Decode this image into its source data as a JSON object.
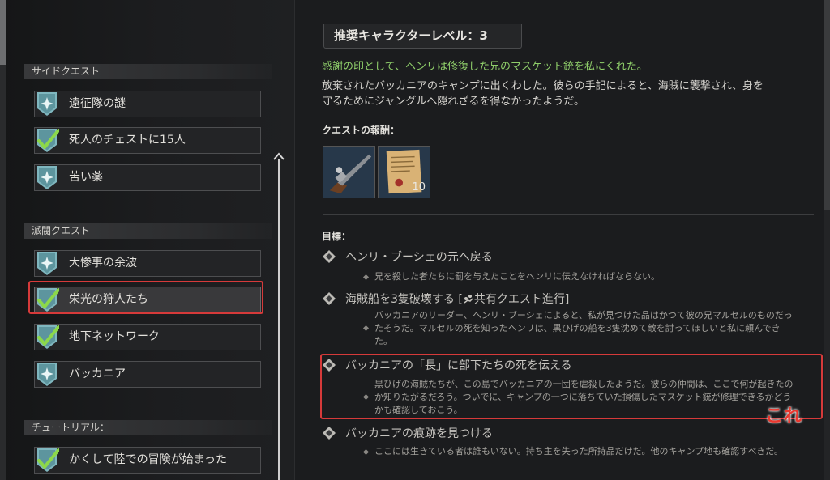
{
  "sidebar": {
    "sections": [
      {
        "title": "サイドクエスト",
        "items": [
          {
            "label": "遠征隊の謎",
            "icon": "compass-shield-icon",
            "completed": false
          },
          {
            "label": "死人のチェストに15人",
            "icon": "checkmark-shield-icon",
            "completed": true
          },
          {
            "label": "苦い薬",
            "icon": "compass-shield-icon",
            "completed": false
          }
        ]
      },
      {
        "title": "派閥クエスト",
        "items": [
          {
            "label": "大惨事の余波",
            "icon": "compass-shield-icon",
            "completed": false
          },
          {
            "label": "栄光の狩人たち",
            "icon": "checkmark-shield-icon",
            "completed": true,
            "selected": true
          },
          {
            "label": "地下ネットワーク",
            "icon": "checkmark-shield-icon",
            "completed": true
          },
          {
            "label": "バッカニア",
            "icon": "compass-shield-icon",
            "completed": false
          }
        ]
      },
      {
        "title": "チュートリアル：",
        "items": [
          {
            "label": "かくして陸での冒険が始まった",
            "icon": "checkmark-shield-icon",
            "completed": true
          }
        ]
      }
    ]
  },
  "detail": {
    "recommended_level": "推奨キャラクターレベル：3",
    "reward_line": "感謝の印として、ヘンリは修復した兄のマスケット銃を私にくれた。",
    "description_lines": [
      "放棄されたバッカニアのキャンプに出くわした。彼らの手記によると、海賊に襲撃され、身を",
      "守るためにジャングルへ隠れざるを得なかったようだ。"
    ],
    "rewards_label": "クエストの報酬：",
    "rewards": [
      {
        "icon": "musket-icon",
        "count": ""
      },
      {
        "icon": "scroll-icon",
        "count": "10"
      }
    ],
    "objectives_label": "目標：",
    "objectives": [
      {
        "title": "ヘンリ・ブーシェの元へ戻る",
        "desc": [
          "兄を殺した者たちに罰を与えたことをヘンリに伝えなければならない。"
        ]
      },
      {
        "title": "海賊船を3隻破壊する [",
        "shared": "共有クエスト進行",
        "title_end": "]",
        "desc": [
          "バッカニアのリーダー、ヘンリ・ブーシェによると、私が見つけた品はかつて彼の兄マルセルのものだっ",
          "たそうだ。マルセルの死を知ったヘンリは、黒ひげの船を3隻沈めて敵を討ってほしいと私に頼んでき",
          "た。"
        ]
      },
      {
        "title": "バッカニアの「長」に部下たちの死を伝える",
        "desc": [
          "黒ひげの海賊たちが、この島でバッカニアの一団を虐殺したようだ。彼らの仲間は、ここで何が起きたの",
          "か知りたがるだろう。ついでに、キャンプの一つに落ちていた損傷したマスケット銃が修理できるかどう",
          "かも確認しておこう。"
        ]
      },
      {
        "title": "バッカニアの痕跡を見つける",
        "desc": [
          "ここには生きている者は誰もいない。持ち主を失った所持品だけだ。他のキャンプ地も確認すべきだ。"
        ]
      }
    ]
  },
  "annotation": {
    "text": "これ",
    "color": "#e8382f"
  },
  "colors": {
    "accent_green": "#8fce6a",
    "highlight_red": "#d63a3a",
    "shield_teal": "#7fb7bf"
  }
}
